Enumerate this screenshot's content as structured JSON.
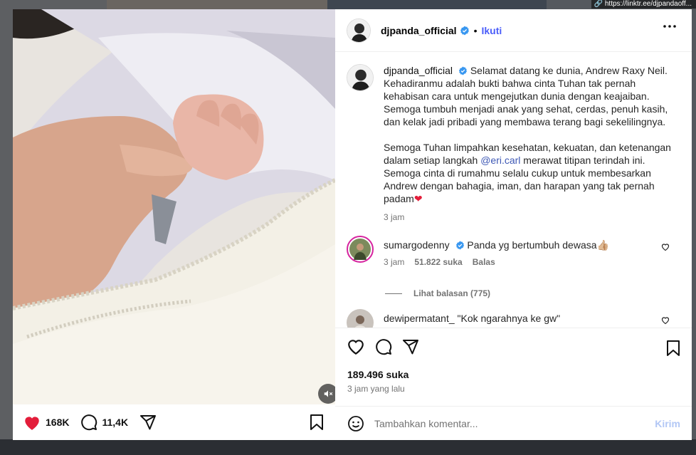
{
  "backdrop": {
    "link_text": "https://linktr.ee/djpandaoff..."
  },
  "post": {
    "username": "djpanda_official",
    "follow_label": "Ikuti",
    "separator": "•",
    "caption": {
      "line1": "Selamat datang ke dunia, Andrew Raxy Neil. Kehadiranmu adalah bukti bahwa cinta Tuhan tak pernah kehabisan cara untuk mengejutkan dunia dengan keajaiban. Semoga tumbuh menjadi anak yang sehat, cerdas, penuh kasih, dan kelak jadi pribadi yang membawa terang bagi sekelilingnya.",
      "p2_before": "Semoga Tuhan limpahkan kesehatan, kekuatan, dan ketenangan dalam setiap langkah ",
      "mention": "@eri.carl",
      "p2_after": " merawat titipan terindah ini. Semoga cinta di rumahmu selalu cukup untuk membesarkan Andrew dengan bahagia, iman, dan harapan yang tak pernah padam",
      "emoji": "❤",
      "time": "3 jam"
    },
    "comments": [
      {
        "username": "sumargodenny",
        "text": "Panda yg bertumbuh dewasa👍🏼",
        "time": "3 jam",
        "likes": "51.822 suka",
        "reply": "Balas",
        "view_replies": "Lihat balasan (775)"
      },
      {
        "username": "dewipermatant_",
        "text": "\"Kok ngarahnya ke gw\"",
        "time": "",
        "likes": "",
        "reply": ""
      }
    ],
    "likes_label": "189.496 suka",
    "posted_label": "3 jam yang lalu",
    "comment_placeholder": "Tambahkan komentar...",
    "send_label": "Kirim"
  },
  "media_bar": {
    "likes": "168K",
    "comments": "11,4K"
  },
  "colors": {
    "accent": "#4a5df9",
    "verified": "#3897f0",
    "heart": "#e31d3a",
    "muted": "#737373"
  }
}
